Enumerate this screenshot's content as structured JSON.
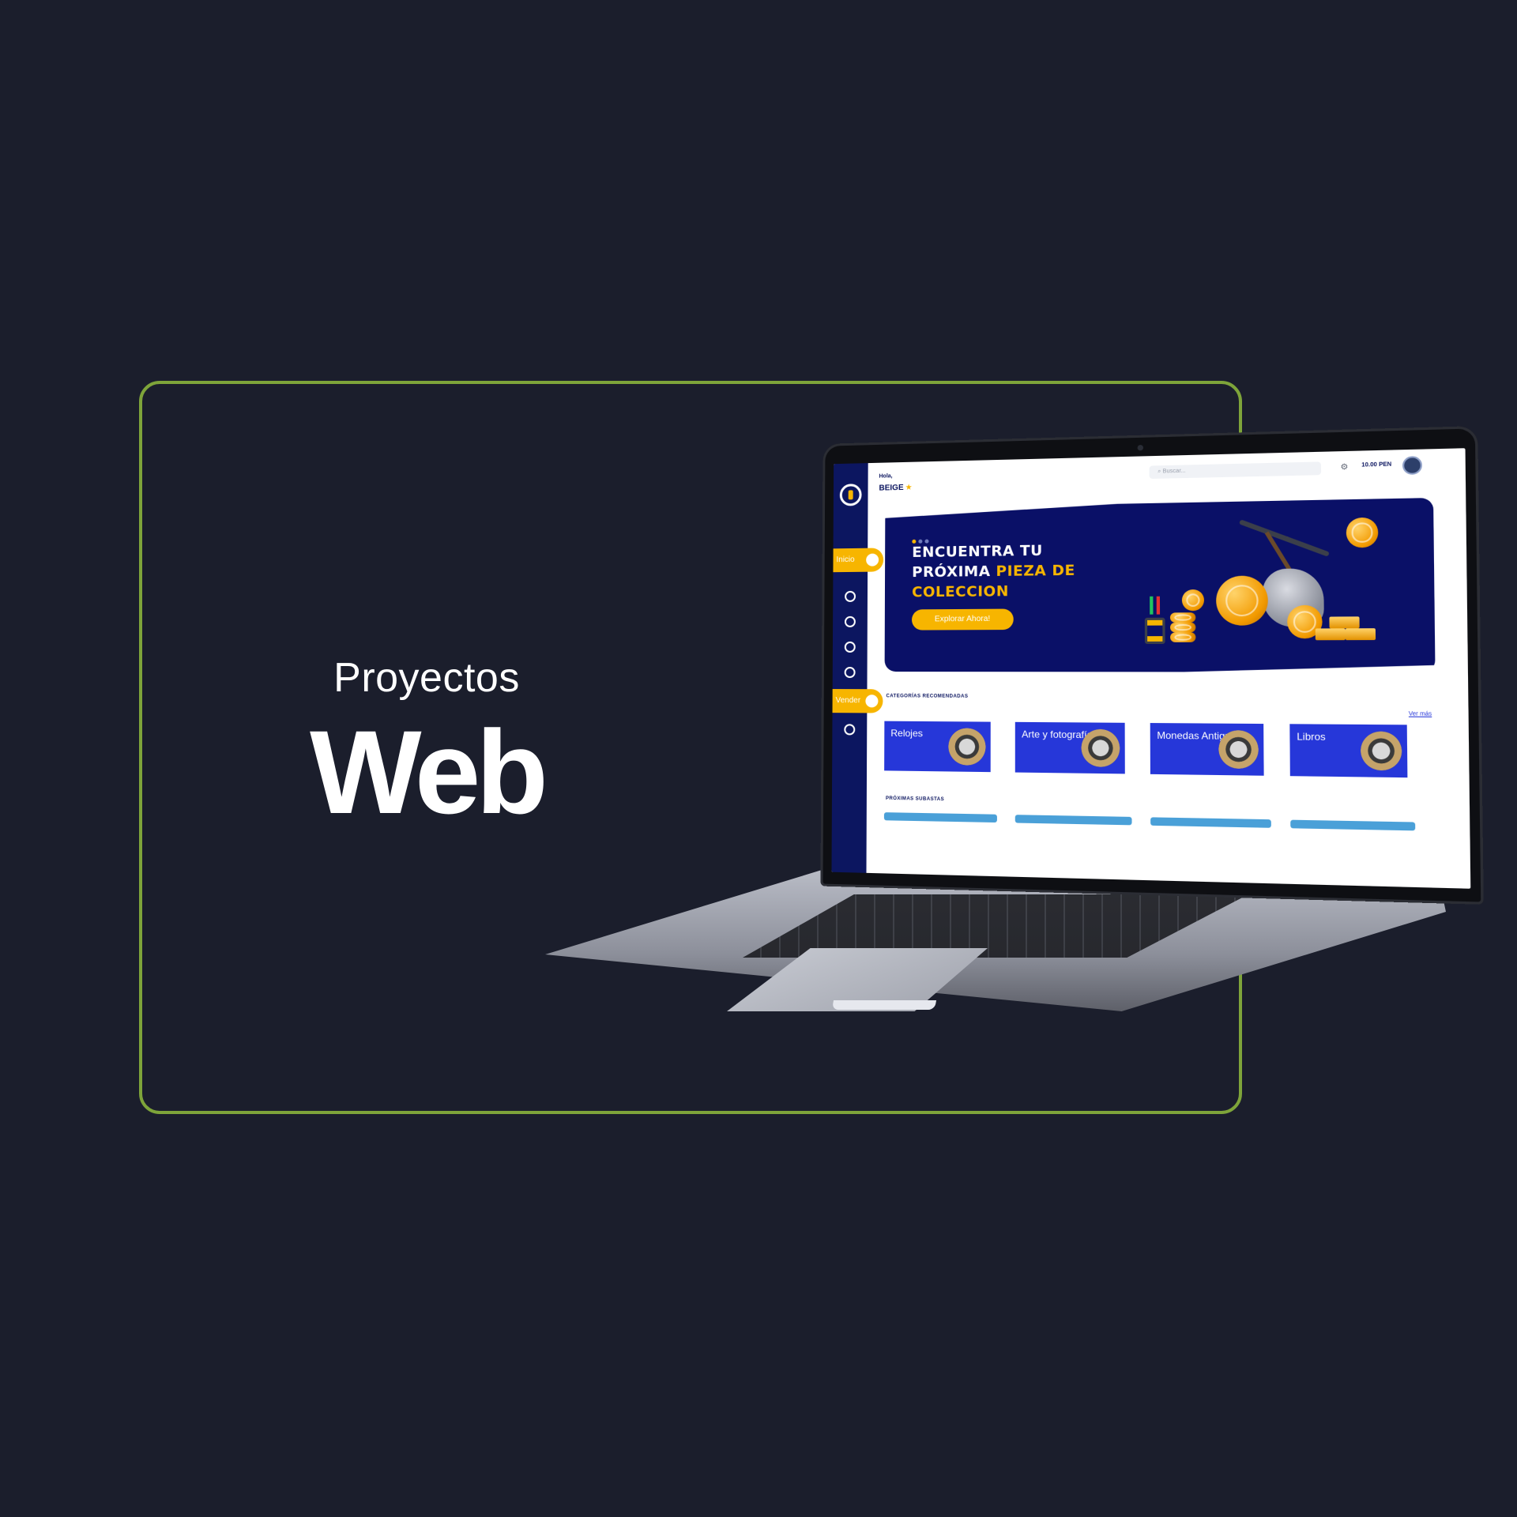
{
  "headline": {
    "subtitle": "Proyectos",
    "title": "Web"
  },
  "colors": {
    "background": "#1b1e2c",
    "frame_border": "#7ea43a",
    "brand_navy": "#0c1660",
    "brand_gold": "#f7b500",
    "card_blue": "#2637d9"
  },
  "app": {
    "sidebar": {
      "items": [
        {
          "label": "Inicio",
          "icon": "home-icon",
          "active": true
        },
        {
          "label": "",
          "icon": "calendar-icon"
        },
        {
          "label": "",
          "icon": "clock-icon"
        },
        {
          "label": "",
          "icon": "list-icon"
        },
        {
          "label": "",
          "icon": "settings-icon"
        },
        {
          "label": "Vender",
          "icon": "tag-icon",
          "active": true
        },
        {
          "label": "",
          "icon": "logout-icon"
        }
      ]
    },
    "topbar": {
      "greeting": "Hola,",
      "user": "BEIGE",
      "search_placeholder": "Buscar...",
      "balance": "10.00 PEN"
    },
    "banner": {
      "title_part1": "ENCUENTRA TU PRÓXIMA ",
      "title_highlight": "PIEZA DE COLECCION",
      "cta": "Explorar Ahora!"
    },
    "categories": {
      "heading": "CATEGORÍAS RECOMENDADAS",
      "see_more": "Ver más",
      "items": [
        "Relojes",
        "Arte y fotografía",
        "Monedas Antiguas",
        "Libros"
      ]
    },
    "upcoming": {
      "heading": "PRÓXIMAS SUBASTAS"
    }
  }
}
